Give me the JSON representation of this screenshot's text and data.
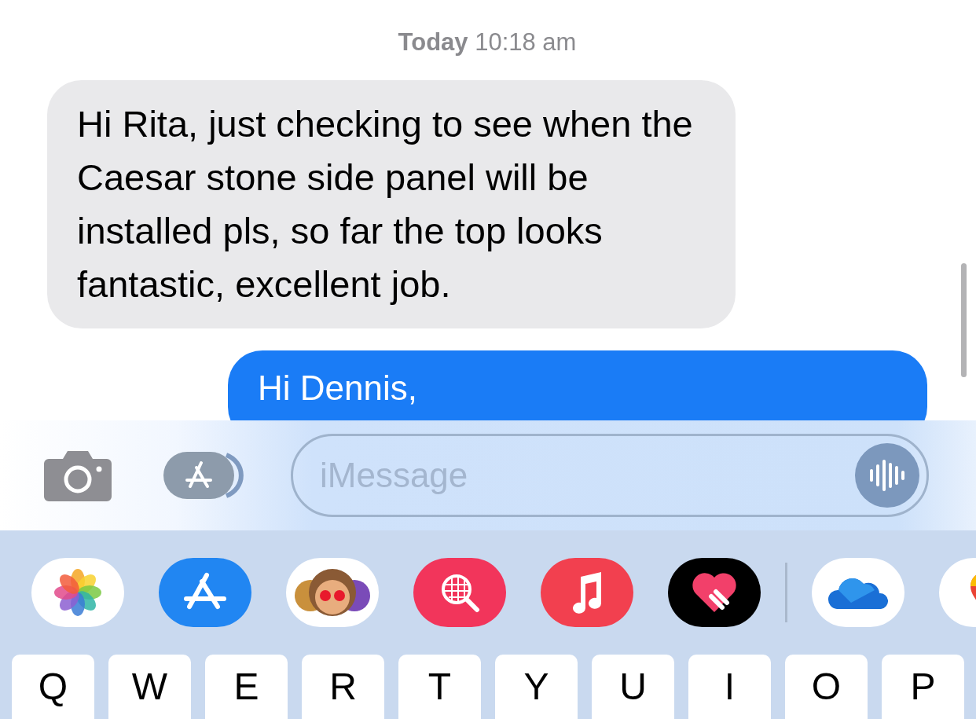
{
  "timestamp": "**Today** 10:18 am",
  "messages": [
    {
      "kind": "incoming",
      "text": "Hi Rita, just checking to see when the Caesar stone side panel will be installed pls, so far the top looks fantastic, excellent job."
    },
    {
      "kind": "outgoing",
      "text": "Hi Dennis,"
    }
  ],
  "compose": {
    "placeholder": "iMessage"
  },
  "apps": [
    {
      "kind": "photos"
    },
    {
      "kind": "store"
    },
    {
      "kind": "memoji"
    },
    {
      "kind": "search"
    },
    {
      "kind": "music"
    },
    {
      "kind": "heart"
    },
    {
      "kind": "divider"
    },
    {
      "kind": "cloud"
    },
    {
      "kind": "maps"
    }
  ],
  "keys": [
    "Q",
    "W",
    "E",
    "R",
    "T",
    "Y",
    "U",
    "I",
    "O",
    "P"
  ]
}
